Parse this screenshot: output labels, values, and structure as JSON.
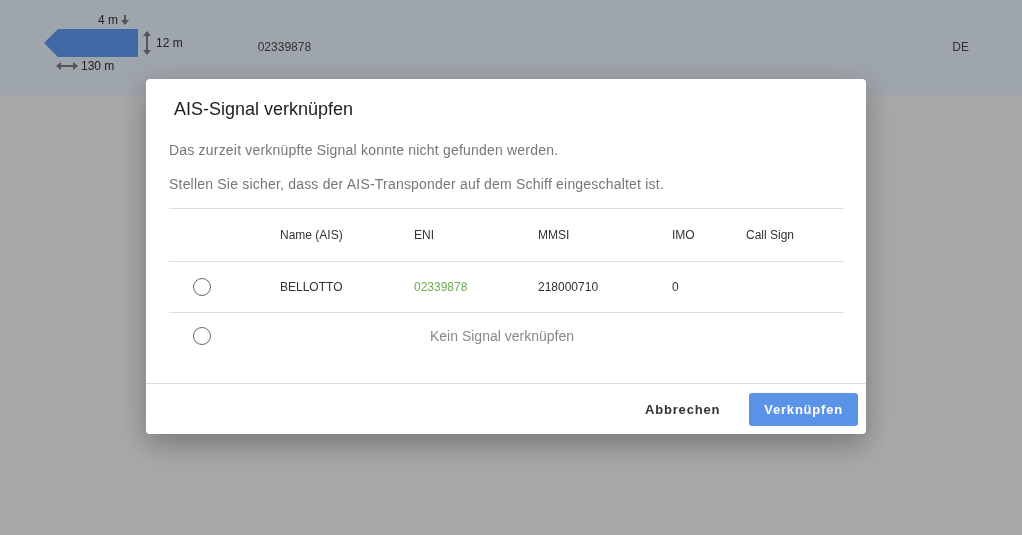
{
  "background": {
    "vessel": {
      "draught": "4 m",
      "beam": "12 m",
      "length": "130 m",
      "eni": "02339878",
      "flag": "DE"
    }
  },
  "dialog": {
    "title": "AIS-Signal verknüpfen",
    "messages": [
      "Das zurzeit verknüpfte Signal konnte nicht gefunden werden.",
      "Stellen Sie sicher, dass der AIS-Transponder auf dem Schiff eingeschaltet ist."
    ],
    "columns": [
      "Name (AIS)",
      "ENI",
      "MMSI",
      "IMO",
      "Call Sign"
    ],
    "rows": [
      {
        "kind": "signal",
        "selected": false,
        "name": "BELLOTTO",
        "eni": "02339878",
        "mmsi": "218000710",
        "imo": "0"
      },
      {
        "kind": "none",
        "selected": false,
        "label": "Kein Signal verknüpfen"
      }
    ],
    "buttons": [
      {
        "kind": "text",
        "label": "Abbrechen"
      },
      {
        "kind": "primary",
        "label": "Verknüpfen"
      }
    ]
  }
}
